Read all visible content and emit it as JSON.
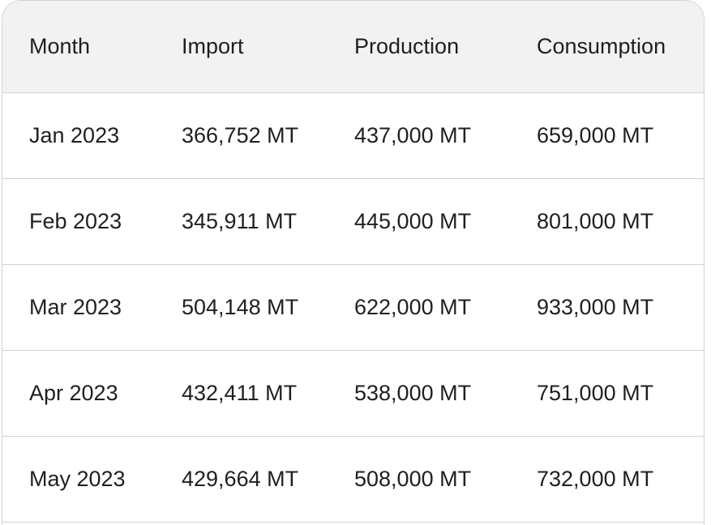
{
  "table": {
    "headers": [
      "Month",
      "Import",
      "Production",
      "Consumption"
    ],
    "rows": [
      [
        "Jan 2023",
        "366,752 MT",
        "437,000 MT",
        "659,000 MT"
      ],
      [
        "Feb 2023",
        "345,911 MT",
        "445,000 MT",
        "801,000 MT"
      ],
      [
        "Mar 2023",
        "504,148 MT",
        "622,000 MT",
        "933,000 MT"
      ],
      [
        "Apr 2023",
        "432,411 MT",
        "538,000 MT",
        "751,000 MT"
      ],
      [
        "May 2023",
        "429,664 MT",
        "508,000 MT",
        "732,000 MT"
      ]
    ]
  }
}
